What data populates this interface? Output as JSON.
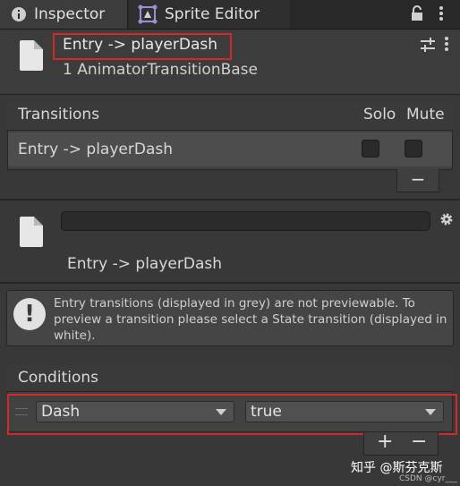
{
  "tabs": [
    {
      "label": "Inspector",
      "icon": "info-icon"
    },
    {
      "label": "Sprite Editor",
      "icon": "sprite-editor-icon"
    }
  ],
  "header": {
    "title": "Entry -> playerDash",
    "subtitle": "1 AnimatorTransitionBase",
    "highlight_color": "#d12a2a"
  },
  "transitions": {
    "header_label": "Transitions",
    "solo_label": "Solo",
    "mute_label": "Mute",
    "rows": [
      {
        "name": "Entry -> playerDash",
        "solo": false,
        "mute": false
      }
    ],
    "remove_label": "−"
  },
  "transition_detail": {
    "name": "Entry -> playerDash"
  },
  "info_box": {
    "icon": "exclamation-icon",
    "text": "Entry transitions (displayed in grey) are not previewable. To preview a transition please select a State transition (displayed in white)."
  },
  "conditions": {
    "header_label": "Conditions",
    "rows": [
      {
        "parameter": "Dash",
        "value": "true"
      }
    ],
    "add_label": "+",
    "remove_label": "−"
  },
  "watermark": {
    "text": "知乎 @斯芬克斯",
    "small": "CSDN @cyr___"
  }
}
